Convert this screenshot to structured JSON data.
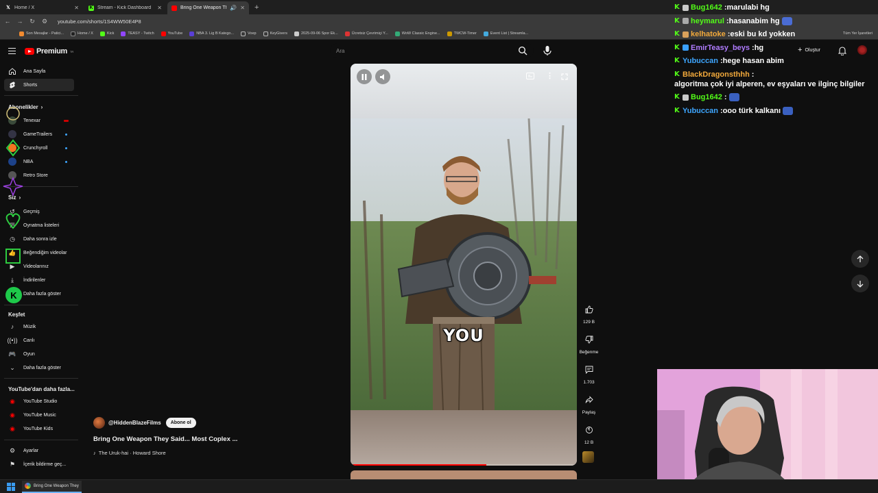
{
  "browser": {
    "tabs": [
      {
        "title": "Home / X",
        "icon": "x-icon",
        "active": false
      },
      {
        "title": "Stream - Kick Dashboard",
        "icon": "kick-icon",
        "active": false
      },
      {
        "title": "Bring One Weapon They Sai",
        "icon": "youtube-icon",
        "active": true
      }
    ],
    "url": "youtube.com/shorts/1S4WW50E4P8",
    "bookmarks": [
      "Son Mesajlar - Patici...",
      "Home / X",
      "Kick",
      "TEASY - Twitch",
      "YouTube",
      "NBA 3. Lig B Katego...",
      "Voep",
      "KeyGivers",
      "2025-09-06 Spor Ek...",
      "Ücretsiz Çevrimiçi Y...",
      "WoW Classic Engine...",
      "TWCW-Timer",
      "Event List | Streamla..."
    ],
    "all_bookmarks_label": "Tüm Yer İşaretleri"
  },
  "youtube": {
    "logo_text": "Premium",
    "logo_sup": "TR",
    "search_placeholder": "Ara",
    "create_label": "Oluştur"
  },
  "sidebar": {
    "main": [
      {
        "label": "Ana Sayfa",
        "icon": "home-icon"
      },
      {
        "label": "Shorts",
        "icon": "shorts-icon",
        "active": true
      }
    ],
    "subs_heading": "Abonelikler",
    "subs": [
      {
        "label": "Tenexar",
        "live": true
      },
      {
        "label": "GameTrailers",
        "dot": true
      },
      {
        "label": "Crunchyroll",
        "dot": true
      },
      {
        "label": "NBA",
        "dot": true
      },
      {
        "label": "Retro Store"
      }
    ],
    "you_heading": "Siz",
    "you": [
      {
        "label": "Geçmiş",
        "icon": "history-icon"
      },
      {
        "label": "Oynatma listeleri",
        "icon": "playlist-icon"
      },
      {
        "label": "Daha sonra izle",
        "icon": "clock-icon"
      },
      {
        "label": "Beğendiğim videolar",
        "icon": "like-icon"
      },
      {
        "label": "Videolarınız",
        "icon": "video-icon"
      },
      {
        "label": "İndirilenler",
        "icon": "download-icon"
      },
      {
        "label": "Daha fazla göster",
        "icon": "chevron-down-icon"
      }
    ],
    "explore_heading": "Keşfet",
    "explore": [
      {
        "label": "Müzik",
        "icon": "music-icon"
      },
      {
        "label": "Canlı",
        "icon": "live-icon"
      },
      {
        "label": "Oyun",
        "icon": "game-icon"
      },
      {
        "label": "Daha fazla göster",
        "icon": "chevron-down-icon"
      }
    ],
    "more_heading": "YouTube'dan daha fazla...",
    "more": [
      {
        "label": "YouTube Studio"
      },
      {
        "label": "YouTube Music"
      },
      {
        "label": "YouTube Kids"
      }
    ],
    "bottom": [
      {
        "label": "Ayarlar",
        "icon": "gear-icon"
      },
      {
        "label": "İçerik bildirme geç...",
        "icon": "flag-icon"
      }
    ]
  },
  "short": {
    "caption": "YOU",
    "progress": 0.6,
    "channel": "@HiddenBlazeFilms",
    "subscribe_label": "Abone ol",
    "title": "Bring One Weapon They Said... Most Coplex ...",
    "music": "The Uruk-hai · Howard Shore",
    "likes": "129 B",
    "dislike_label": "Beğenme",
    "comments": "1.703",
    "share_label": "Paylaş",
    "remix": "12 B"
  },
  "chat": [
    {
      "user": "Bug1642",
      "color": "#53fc18",
      "text": "marulabi hg",
      "badge": "#c9c9c9"
    },
    {
      "user": "heymarul",
      "color": "#53fc18",
      "text": "hasanabim hg",
      "badge": "#aaaaaa",
      "emote": "#4a6cd4"
    },
    {
      "user": "kelhatoke",
      "color": "#f2a93b",
      "text": "eski bu kd yokken",
      "badge": "#d9a05b"
    },
    {
      "user": "EmirTeasy_beys",
      "color": "#b07cff",
      "text": "hg",
      "badge": "#3aa0ff"
    },
    {
      "user": "Yubuccan",
      "color": "#3ea6ff",
      "text": "hege hasan abim"
    },
    {
      "user": "BlackDragonsthhh",
      "color": "#f2a93b",
      "text": "algoritma çok iyi alperen, ev eşyaları ve ilginç bilgiler"
    },
    {
      "user": "Bug1642",
      "color": "#53fc18",
      "text": "",
      "badge": "#c9c9c9",
      "emote": "#3a60c0"
    },
    {
      "user": "Yubuccan",
      "color": "#3ea6ff",
      "text": "ooo türk kalkanı",
      "emote": "#3a60c0"
    }
  ],
  "taskbar": {
    "app_title": "Bring One Weapon They"
  },
  "colors": {
    "accent": "#ff0000",
    "kick_green": "#53fc18",
    "link_blue": "#3ea6ff"
  }
}
